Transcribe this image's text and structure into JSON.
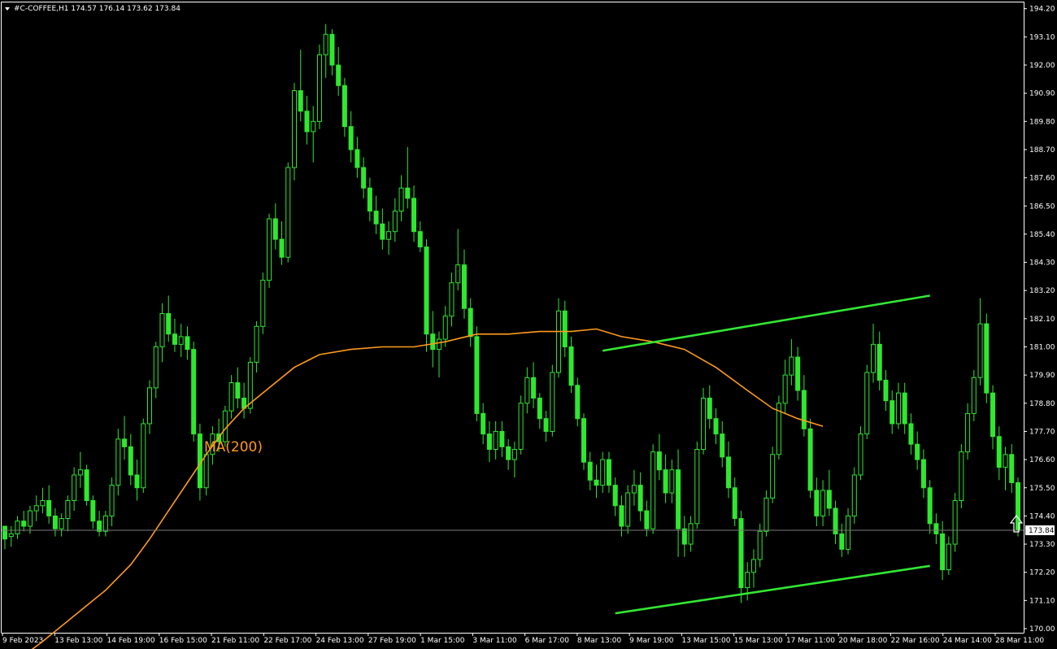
{
  "header": {
    "symbol_line": "#C-COFFEE,H1  174.57 176.14 173.62 173.84"
  },
  "colors": {
    "background": "#000000",
    "candle": "#2ee82e",
    "ma": "#ff9a1f",
    "channel": "#33e833",
    "frame": "#ffffff",
    "price_line": "#7a7a7a"
  },
  "chart_data": {
    "type": "candlestick",
    "symbol": "#C-COFFEE",
    "timeframe": "H1",
    "ohlc_header": {
      "open": 174.57,
      "high": 176.14,
      "low": 173.62,
      "close": 173.84
    },
    "current_price": "173.84",
    "ylim": [
      170.0,
      194.65
    ],
    "y_ticks": [
      "194.20",
      "193.10",
      "192.00",
      "190.90",
      "189.80",
      "188.70",
      "187.60",
      "186.50",
      "185.40",
      "184.30",
      "183.20",
      "182.10",
      "181.00",
      "179.90",
      "178.80",
      "177.70",
      "176.60",
      "175.50",
      "174.40",
      "173.30",
      "172.20",
      "171.10",
      "170.00"
    ],
    "x_ticks": [
      "9 Feb 2023",
      "13 Feb 13:00",
      "14 Feb 19:00",
      "16 Feb 15:00",
      "21 Feb 11:00",
      "22 Feb 17:00",
      "24 Feb 13:00",
      "27 Feb 19:00",
      "1 Mar 15:00",
      "3 Mar 11:00",
      "6 Mar 17:00",
      "8 Mar 13:00",
      "9 Mar 19:00",
      "13 Mar 15:00",
      "15 Mar 13:00",
      "17 Mar 11:00",
      "20 Mar 18:00",
      "22 Mar 16:00",
      "24 Mar 14:00",
      "28 Mar 11:00"
    ],
    "indicator": {
      "name": "MA(200)",
      "label": "MA(200)"
    },
    "ma_path": [
      [
        0,
        168.4
      ],
      [
        6,
        169.5
      ],
      [
        11,
        170.5
      ],
      [
        16,
        171.5
      ],
      [
        20,
        172.5
      ],
      [
        23,
        173.5
      ],
      [
        26,
        174.6
      ],
      [
        29,
        175.7
      ],
      [
        32,
        176.8
      ],
      [
        35,
        177.8
      ],
      [
        38,
        178.6
      ],
      [
        42,
        179.4
      ],
      [
        46,
        180.2
      ],
      [
        50,
        180.7
      ],
      [
        55,
        180.9
      ],
      [
        60,
        181.0
      ],
      [
        65,
        181.0
      ],
      [
        70,
        181.2
      ],
      [
        75,
        181.5
      ],
      [
        80,
        181.5
      ],
      [
        85,
        181.6
      ],
      [
        90,
        181.6
      ],
      [
        94,
        181.7
      ],
      [
        98,
        181.4
      ],
      [
        103,
        181.2
      ],
      [
        108,
        180.9
      ],
      [
        113,
        180.2
      ],
      [
        118,
        179.3
      ],
      [
        122,
        178.6
      ],
      [
        126,
        178.2
      ],
      [
        130,
        177.9
      ]
    ],
    "trend_channel": {
      "upper": [
        [
          95,
          180.85
        ],
        [
          147,
          183.0
        ]
      ],
      "lower": [
        [
          97,
          170.6
        ],
        [
          147,
          172.45
        ]
      ]
    },
    "candles": [
      [
        174.0,
        174.0,
        173.1,
        173.5
      ],
      [
        173.6,
        174.0,
        173.2,
        173.7
      ],
      [
        173.7,
        174.4,
        173.5,
        174.2
      ],
      [
        174.2,
        174.6,
        173.8,
        174.0
      ],
      [
        174.0,
        174.8,
        173.7,
        174.6
      ],
      [
        174.6,
        175.2,
        174.2,
        174.8
      ],
      [
        174.8,
        175.5,
        174.5,
        175.0
      ],
      [
        175.0,
        175.6,
        174.1,
        174.4
      ],
      [
        174.4,
        174.7,
        173.6,
        173.9
      ],
      [
        173.9,
        174.5,
        173.6,
        174.3
      ],
      [
        174.3,
        175.2,
        173.8,
        175.0
      ],
      [
        175.0,
        176.3,
        174.6,
        176.0
      ],
      [
        176.0,
        176.9,
        175.5,
        176.2
      ],
      [
        176.2,
        176.4,
        174.8,
        175.0
      ],
      [
        175.0,
        175.2,
        173.9,
        174.2
      ],
      [
        174.2,
        174.6,
        173.6,
        173.8
      ],
      [
        173.8,
        174.6,
        173.6,
        174.4
      ],
      [
        174.4,
        175.9,
        174.0,
        175.6
      ],
      [
        175.6,
        177.8,
        175.2,
        177.4
      ],
      [
        177.4,
        178.3,
        176.6,
        177.1
      ],
      [
        177.1,
        177.6,
        175.6,
        176.0
      ],
      [
        176.0,
        176.6,
        175.0,
        175.5
      ],
      [
        175.5,
        178.2,
        175.3,
        178.0
      ],
      [
        178.0,
        179.7,
        177.6,
        179.4
      ],
      [
        179.4,
        181.2,
        179.0,
        181.0
      ],
      [
        181.0,
        182.7,
        180.4,
        182.3
      ],
      [
        182.3,
        183.0,
        181.2,
        181.5
      ],
      [
        181.5,
        182.1,
        180.8,
        181.1
      ],
      [
        181.1,
        181.9,
        180.6,
        181.4
      ],
      [
        181.4,
        181.8,
        180.5,
        180.9
      ],
      [
        180.9,
        181.2,
        177.3,
        177.6
      ],
      [
        177.6,
        178.0,
        175.0,
        175.5
      ],
      [
        175.5,
        177.0,
        175.2,
        176.8
      ],
      [
        176.8,
        177.9,
        176.4,
        177.6
      ],
      [
        177.6,
        178.2,
        176.9,
        177.3
      ],
      [
        177.3,
        178.7,
        177.1,
        178.5
      ],
      [
        178.5,
        179.9,
        178.2,
        179.6
      ],
      [
        179.6,
        180.2,
        178.6,
        179.0
      ],
      [
        179.0,
        179.6,
        178.2,
        178.6
      ],
      [
        178.6,
        180.6,
        178.4,
        180.4
      ],
      [
        180.4,
        182.0,
        180.0,
        181.8
      ],
      [
        181.8,
        183.9,
        181.5,
        183.6
      ],
      [
        183.6,
        186.2,
        183.3,
        186.0
      ],
      [
        186.0,
        186.6,
        184.8,
        185.2
      ],
      [
        185.2,
        185.9,
        184.2,
        184.5
      ],
      [
        184.5,
        188.2,
        184.3,
        188.0
      ],
      [
        188.0,
        191.3,
        187.5,
        191.0
      ],
      [
        191.0,
        192.6,
        189.8,
        190.2
      ],
      [
        190.2,
        190.8,
        188.9,
        189.4
      ],
      [
        189.4,
        190.4,
        188.2,
        189.8
      ],
      [
        189.8,
        192.8,
        189.5,
        192.4
      ],
      [
        192.4,
        193.6,
        191.5,
        193.2
      ],
      [
        193.2,
        193.4,
        191.6,
        192.0
      ],
      [
        192.0,
        192.7,
        190.8,
        191.2
      ],
      [
        191.2,
        191.5,
        189.2,
        189.6
      ],
      [
        189.6,
        190.2,
        188.2,
        188.7
      ],
      [
        188.7,
        189.2,
        187.6,
        188.0
      ],
      [
        188.0,
        188.4,
        186.8,
        187.2
      ],
      [
        187.2,
        187.6,
        185.9,
        186.3
      ],
      [
        186.3,
        186.9,
        185.4,
        185.8
      ],
      [
        185.8,
        186.4,
        184.8,
        185.2
      ],
      [
        185.2,
        185.9,
        184.6,
        185.5
      ],
      [
        185.5,
        186.8,
        185.1,
        186.3
      ],
      [
        186.3,
        187.7,
        185.9,
        187.2
      ],
      [
        187.2,
        188.8,
        186.4,
        186.8
      ],
      [
        186.8,
        187.3,
        185.1,
        185.5
      ],
      [
        185.5,
        185.9,
        184.7,
        184.9
      ],
      [
        184.9,
        185.2,
        180.8,
        181.5
      ],
      [
        181.5,
        182.4,
        180.2,
        180.9
      ],
      [
        180.9,
        181.6,
        179.8,
        181.3
      ],
      [
        181.3,
        182.6,
        181.0,
        182.2
      ],
      [
        182.2,
        183.9,
        181.8,
        183.5
      ],
      [
        183.5,
        185.6,
        183.2,
        184.2
      ],
      [
        184.2,
        184.8,
        182.1,
        182.5
      ],
      [
        182.5,
        182.9,
        181.0,
        181.4
      ],
      [
        181.4,
        181.8,
        178.1,
        178.4
      ],
      [
        178.4,
        178.8,
        177.2,
        177.6
      ],
      [
        177.6,
        178.1,
        176.5,
        177.0
      ],
      [
        177.0,
        178.1,
        176.6,
        177.7
      ],
      [
        177.7,
        178.1,
        176.7,
        177.1
      ],
      [
        177.1,
        177.4,
        176.2,
        176.6
      ],
      [
        176.6,
        177.3,
        175.9,
        177.0
      ],
      [
        177.0,
        179.1,
        176.8,
        178.8
      ],
      [
        178.8,
        180.2,
        178.4,
        179.8
      ],
      [
        179.8,
        180.4,
        178.6,
        179.0
      ],
      [
        179.0,
        179.2,
        177.8,
        178.2
      ],
      [
        178.2,
        178.5,
        177.3,
        177.7
      ],
      [
        177.7,
        180.3,
        177.5,
        180.0
      ],
      [
        180.0,
        182.9,
        179.8,
        182.4
      ],
      [
        182.4,
        182.8,
        180.6,
        181.0
      ],
      [
        181.0,
        181.4,
        179.2,
        179.5
      ],
      [
        179.5,
        179.8,
        177.9,
        178.2
      ],
      [
        178.2,
        178.4,
        176.2,
        176.5
      ],
      [
        176.5,
        176.9,
        175.4,
        175.8
      ],
      [
        175.8,
        176.4,
        175.1,
        175.6
      ],
      [
        175.6,
        176.9,
        175.3,
        176.6
      ],
      [
        176.6,
        176.9,
        175.3,
        175.6
      ],
      [
        175.6,
        175.9,
        174.4,
        174.8
      ],
      [
        174.8,
        175.2,
        173.6,
        174.0
      ],
      [
        174.0,
        175.6,
        173.7,
        175.3
      ],
      [
        175.3,
        176.2,
        174.8,
        175.6
      ],
      [
        175.6,
        176.1,
        174.2,
        174.6
      ],
      [
        174.6,
        175.0,
        173.6,
        173.9
      ],
      [
        173.9,
        177.2,
        173.7,
        176.9
      ],
      [
        176.9,
        177.6,
        175.8,
        176.2
      ],
      [
        176.2,
        176.8,
        174.9,
        175.3
      ],
      [
        175.3,
        176.6,
        174.9,
        176.2
      ],
      [
        176.2,
        177.0,
        172.8,
        173.9
      ],
      [
        173.9,
        174.4,
        172.8,
        173.3
      ],
      [
        173.3,
        174.4,
        173.0,
        174.1
      ],
      [
        174.1,
        177.3,
        173.9,
        177.0
      ],
      [
        177.0,
        179.4,
        176.8,
        179.0
      ],
      [
        179.0,
        179.5,
        177.8,
        178.2
      ],
      [
        178.2,
        178.6,
        177.2,
        177.6
      ],
      [
        177.6,
        178.1,
        176.3,
        176.7
      ],
      [
        176.7,
        177.3,
        175.1,
        175.5
      ],
      [
        175.5,
        175.9,
        174.0,
        174.3
      ],
      [
        174.3,
        174.6,
        171.0,
        171.6
      ],
      [
        171.6,
        172.6,
        171.1,
        172.2
      ],
      [
        172.2,
        173.1,
        171.6,
        172.7
      ],
      [
        172.7,
        174.1,
        172.4,
        173.8
      ],
      [
        173.8,
        175.4,
        173.6,
        175.1
      ],
      [
        175.1,
        177.1,
        174.9,
        176.8
      ],
      [
        176.8,
        179.1,
        176.6,
        178.8
      ],
      [
        178.8,
        180.5,
        178.4,
        179.9
      ],
      [
        179.9,
        181.3,
        179.5,
        180.6
      ],
      [
        180.6,
        181.0,
        178.9,
        179.3
      ],
      [
        179.3,
        179.9,
        177.5,
        177.8
      ],
      [
        177.8,
        178.2,
        175.1,
        175.4
      ],
      [
        175.4,
        175.9,
        174.0,
        174.4
      ],
      [
        174.4,
        175.8,
        174.0,
        175.4
      ],
      [
        175.4,
        176.2,
        174.4,
        174.7
      ],
      [
        174.7,
        175.0,
        173.3,
        173.7
      ],
      [
        173.7,
        174.1,
        172.8,
        173.1
      ],
      [
        173.1,
        174.7,
        172.9,
        174.4
      ],
      [
        174.4,
        176.3,
        174.1,
        176.0
      ],
      [
        176.0,
        177.9,
        175.8,
        177.6
      ],
      [
        177.6,
        180.3,
        177.4,
        180.0
      ],
      [
        180.0,
        181.9,
        179.6,
        181.1
      ],
      [
        181.1,
        181.6,
        179.3,
        179.7
      ],
      [
        179.7,
        180.1,
        178.5,
        178.9
      ],
      [
        178.9,
        179.3,
        177.6,
        178.0
      ],
      [
        178.0,
        179.6,
        177.8,
        179.2
      ],
      [
        179.2,
        179.6,
        177.6,
        178.0
      ],
      [
        178.0,
        178.4,
        176.8,
        177.2
      ],
      [
        177.2,
        177.7,
        176.2,
        176.6
      ],
      [
        176.6,
        177.0,
        175.1,
        175.5
      ],
      [
        175.5,
        175.8,
        173.7,
        174.1
      ],
      [
        174.1,
        174.5,
        173.3,
        173.7
      ],
      [
        173.7,
        174.2,
        171.9,
        172.3
      ],
      [
        172.3,
        173.6,
        172.1,
        173.3
      ],
      [
        173.3,
        175.3,
        173.0,
        175.0
      ],
      [
        175.0,
        177.2,
        174.7,
        176.9
      ],
      [
        176.9,
        178.8,
        176.6,
        178.4
      ],
      [
        178.4,
        180.1,
        178.1,
        179.8
      ],
      [
        179.8,
        182.9,
        179.5,
        181.9
      ],
      [
        181.9,
        182.3,
        178.8,
        179.2
      ],
      [
        179.2,
        179.5,
        177.0,
        177.5
      ],
      [
        177.5,
        177.9,
        175.8,
        176.3
      ],
      [
        176.3,
        177.1,
        175.4,
        176.8
      ],
      [
        176.8,
        177.2,
        175.3,
        175.7
      ],
      [
        175.7,
        175.9,
        173.6,
        173.84
      ]
    ]
  }
}
